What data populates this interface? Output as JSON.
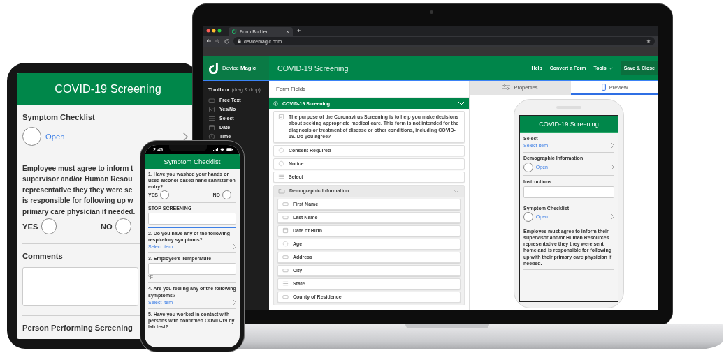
{
  "tablet": {
    "title": "COVID-19 Screening",
    "fields": [
      {
        "kind": "subform",
        "label": "Symptom Checklist",
        "value": "Open"
      },
      {
        "kind": "yesno",
        "lines": [
          "Employee must agree to inform t",
          "supervisor and/or Human Resou",
          "representative they they were se",
          "is responsible for following up w",
          "primary care physician if needed."
        ],
        "yes": "YES",
        "yes_checked": false,
        "no": "NO",
        "no_checked": false
      },
      {
        "kind": "text",
        "label": "Comments"
      },
      {
        "kind": "label",
        "label": "Person Performing Screening"
      }
    ]
  },
  "laptop": {
    "browser": {
      "tab_title": "Form Builder",
      "tab_close": "×",
      "new_tab": "+",
      "address": "devicemagic.com"
    },
    "header": {
      "logo": "Device **Magic**",
      "title": "COVID-19 Screening",
      "nav": [
        {
          "kind": "link",
          "label": "Help"
        },
        {
          "kind": "link",
          "label": "Convert a Form"
        },
        {
          "kind": "menu",
          "label": "Tools"
        },
        {
          "kind": "button",
          "label": "Save & Close"
        }
      ]
    },
    "toolbox": {
      "title": "Toolbox",
      "hint": "(drag & drop)",
      "items": [
        {
          "kind": "text",
          "label": "Free Text"
        },
        {
          "kind": "checkbox",
          "label": "Yes/No"
        },
        {
          "kind": "list",
          "label": "Select"
        },
        {
          "kind": "date",
          "label": "Date"
        },
        {
          "kind": "clock",
          "label": "Time"
        }
      ]
    },
    "form_fields": {
      "title": "Form Fields",
      "section": {
        "title": "COVID-19 Screening",
        "expanded": true,
        "items": [
          {
            "kind": "checkbox",
            "label": "The purpose of the Coronavirus Screening is to help you make decisions about seeking appropriate medical care. This form is not intended for the diagnosis or treatment of disease or other conditions, including COVID-19. Do you agree?"
          },
          {
            "kind": "radio",
            "label": "Consent Required"
          },
          {
            "kind": "radio",
            "label": "Notice"
          },
          {
            "kind": "list",
            "label": "Select"
          },
          {
            "kind": "folder",
            "label": "Demographic Information",
            "expanded": true,
            "children": [
              {
                "kind": "text",
                "label": "First Name"
              },
              {
                "kind": "text",
                "label": "Last Name"
              },
              {
                "kind": "date",
                "label": "Date of Birth"
              },
              {
                "kind": "radio",
                "label": "Age"
              },
              {
                "kind": "text",
                "label": "Address"
              },
              {
                "kind": "text",
                "label": "City"
              },
              {
                "kind": "list",
                "label": "State"
              },
              {
                "kind": "text",
                "label": "County of Residence"
              }
            ]
          }
        ]
      }
    },
    "panel": {
      "tabs": [
        {
          "kind": "properties",
          "label": "Properties",
          "selected": false
        },
        {
          "kind": "preview",
          "label": "Preview",
          "selected": true
        }
      ],
      "preview": {
        "title": "COVID-19 Screening",
        "fields": [
          {
            "kind": "select",
            "label": "Select",
            "value": "Select Item"
          },
          {
            "kind": "subform",
            "label": "Demographic Information",
            "value": "Open"
          },
          {
            "kind": "text",
            "label": "Instructions"
          },
          {
            "kind": "subform",
            "label": "Symptom Checklist",
            "value": "Open"
          },
          {
            "kind": "label",
            "label": "Employee must agree to inform their supervisor and/or Human Resources representative they they were sent home and is responsible for following up with their primary care physician if needed."
          }
        ]
      }
    }
  },
  "phone": {
    "time": "2:45",
    "title": "Symptom Checklist",
    "fields": [
      {
        "kind": "yesno",
        "label": "1. Have you washed your hands or used alcohol-based hand sanitizer on entry?",
        "yes": "YES",
        "yes_checked": false,
        "no": "NO",
        "no_checked": false
      },
      {
        "kind": "text",
        "label": "STOP SCREENING",
        "focused": true
      },
      {
        "kind": "select",
        "label": "2. Do you have any of the following respiratory symptoms?",
        "value": "Select Item"
      },
      {
        "kind": "text",
        "label": "3. Employee's Temperature",
        "unit": "°F",
        "focused": false
      },
      {
        "kind": "select",
        "label": "4. Are you feeling any of the following symptoms?",
        "value": "Select Item"
      },
      {
        "kind": "label",
        "label": "5. Have you worked in contact with persons with confirmed COVID-19 by lab test?"
      }
    ]
  }
}
